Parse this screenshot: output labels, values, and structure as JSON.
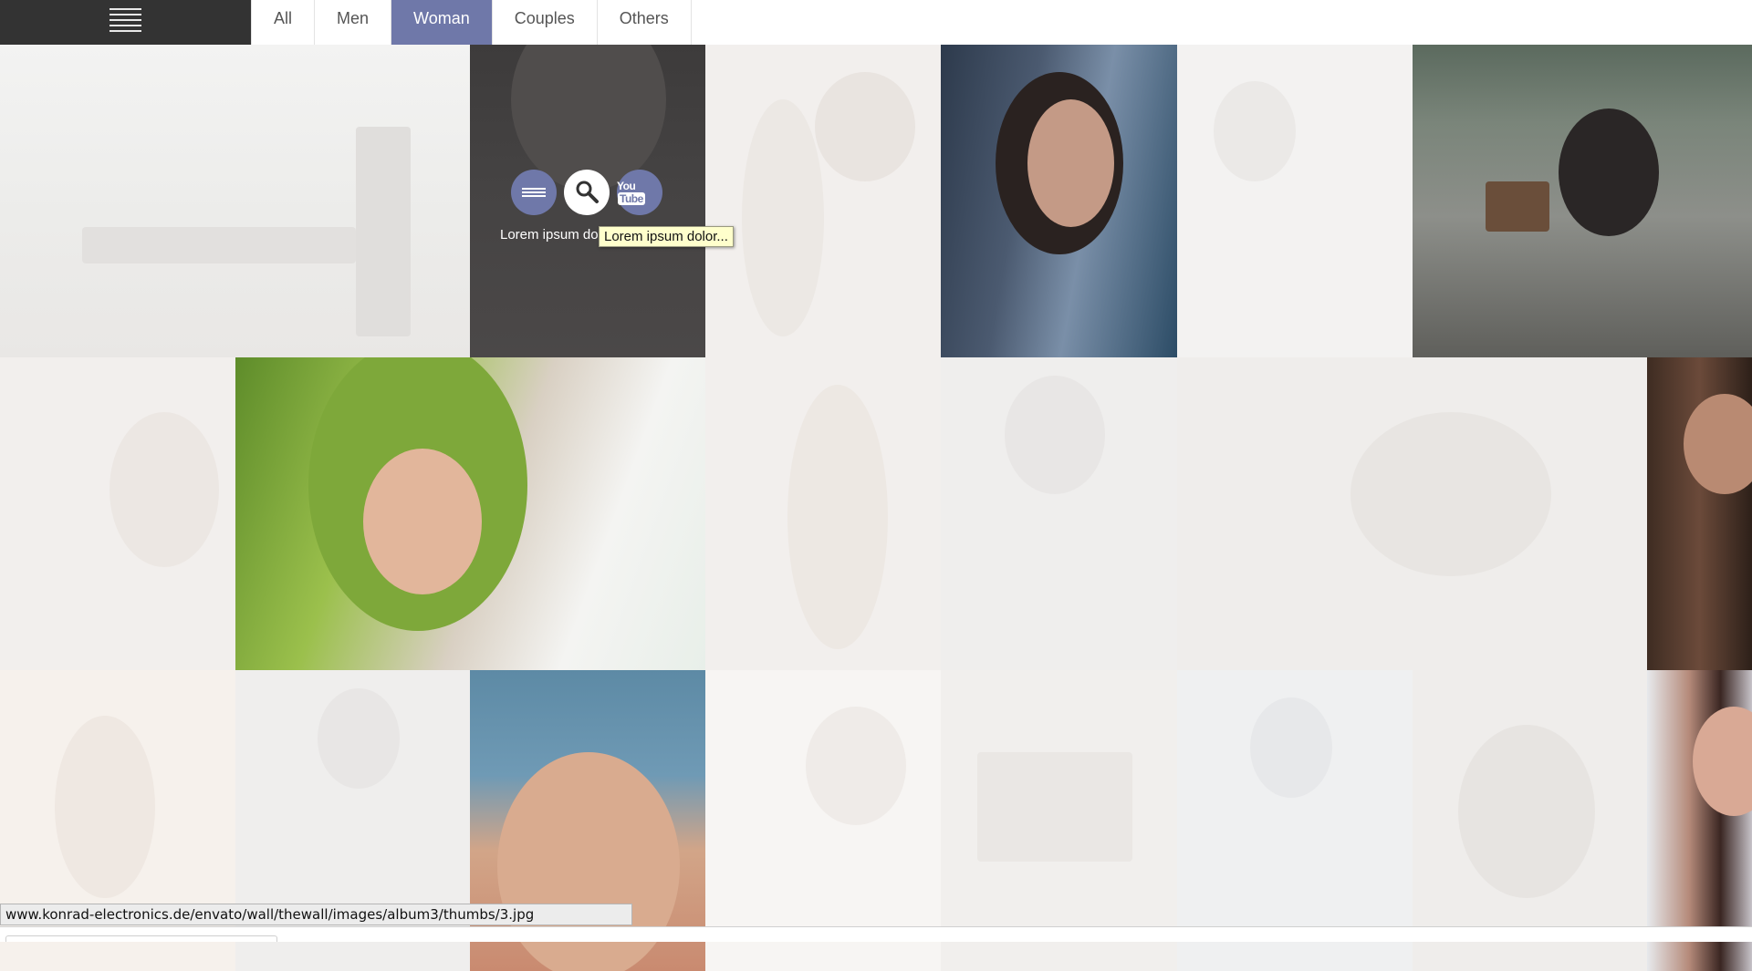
{
  "menu": {
    "icon": "hamburger-icon"
  },
  "filters": {
    "tabs": [
      {
        "label": "All",
        "active": false
      },
      {
        "label": "Men",
        "active": false
      },
      {
        "label": "Woman",
        "active": true
      },
      {
        "label": "Couples",
        "active": false
      },
      {
        "label": "Others",
        "active": false
      }
    ]
  },
  "hover": {
    "caption": "Lorem ipsum dolor...",
    "icons": [
      "list-icon",
      "zoom-icon",
      "youtube-icon"
    ],
    "youtube_text": {
      "you": "You",
      "tube": "Tube"
    }
  },
  "tooltip": {
    "text": "Lorem ipsum dolor..."
  },
  "status_bar": {
    "url": "www.konrad-electronics.de/envato/wall/thewall/images/album3/thumbs/3.jpg"
  },
  "colors": {
    "accent": "#6f78a9",
    "menu_bg": "#333333",
    "tooltip_bg": "#ffffcc"
  }
}
